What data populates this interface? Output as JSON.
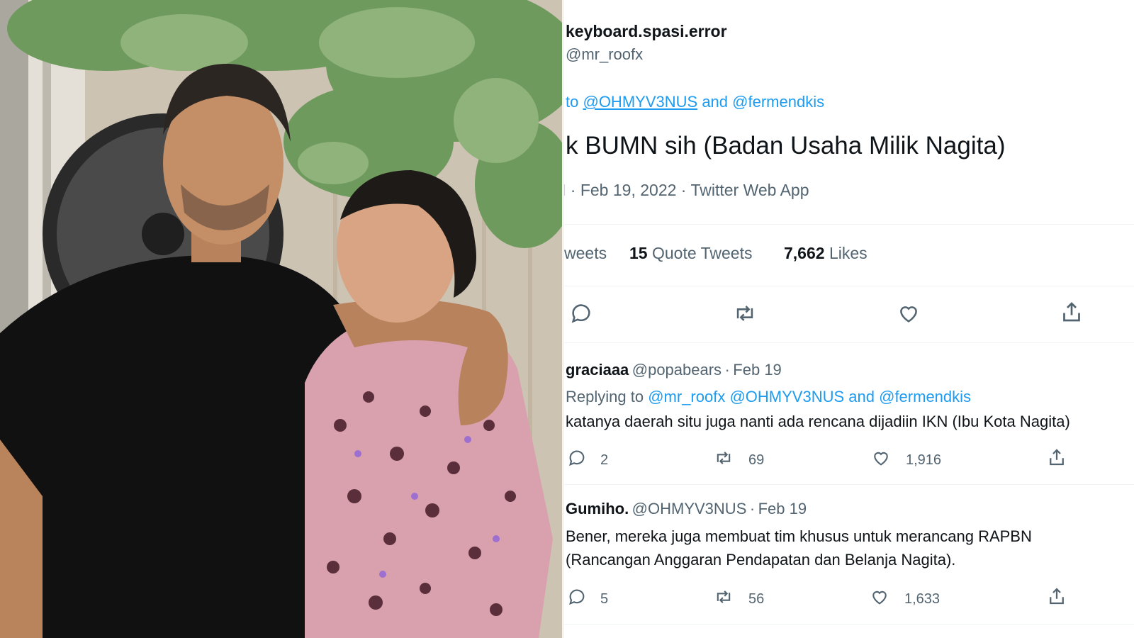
{
  "photo": {
    "alt_subjects": [
      "man in black polo shirt",
      "woman in pink leopard pajamas"
    ]
  },
  "tweet": {
    "display_name": "keyboard.spasi.error",
    "handle": "@mr_roofx",
    "replying_prefix": "to",
    "replying_user1": "@OHMYV3NUS",
    "replying_and": "and",
    "replying_user2": "@fermendkis",
    "text": "k BUMN sih (Badan Usaha Milik Nagita)",
    "meta_lead": "I",
    "meta_sep1": "·",
    "date": "Feb 19, 2022",
    "meta_sep2": "·",
    "source": "Twitter Web App",
    "stats": {
      "retweets_label": "weets",
      "quote_count": "15",
      "quote_label": "Quote Tweets",
      "likes_count": "7,662",
      "likes_label": "Likes"
    }
  },
  "actions": [
    "reply-icon",
    "retweet-icon",
    "like-icon",
    "share-icon"
  ],
  "replies": [
    {
      "name": "graciaaa",
      "handle": "@popabears",
      "sep": "·",
      "date": "Feb 19",
      "replying_prefix": "Replying to",
      "replying_users": "@mr_roofx @OHMYV3NUS",
      "replying_and": "and",
      "replying_last": "@fermendkis",
      "text_line1": "katanya daerah situ juga nanti ada rencana dijadiin IKN (Ibu Kota Nagita)",
      "reply_count": "2",
      "retweet_count": "69",
      "like_count": "1,916"
    },
    {
      "name": "Gumiho.",
      "handle": "@OHMYV3NUS",
      "sep": "·",
      "date": "Feb 19",
      "text_line1": "Bener, mereka juga membuat tim khusus untuk merancang RAPBN",
      "text_line2": "(Rancangan Anggaran Pendapatan dan Belanja Nagita).",
      "reply_count": "5",
      "retweet_count": "56",
      "like_count": "1,633"
    }
  ],
  "colors": {
    "link": "#1d9bf0",
    "muted": "#536471",
    "text": "#0f1419",
    "border": "#eff3f4"
  }
}
